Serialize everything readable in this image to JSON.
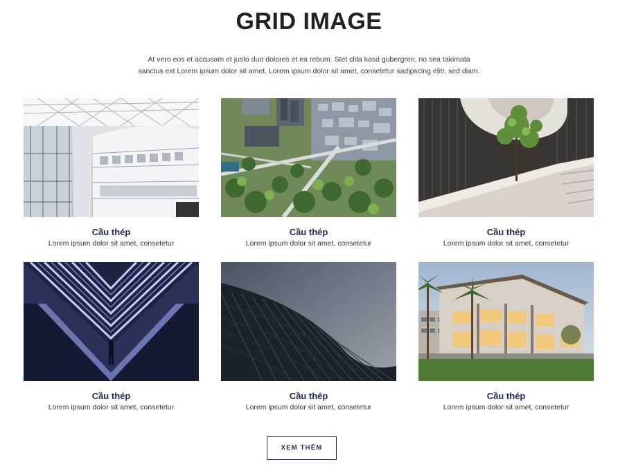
{
  "header": {
    "title": "GRID IMAGE",
    "description_line1": "At vero eos et accusam et justo duo dolores et ea rebum. Stet clita kasd gubergren, no sea takimata",
    "description_line2": "sanctus est Lorem ipsum dolor sit amet. Lorem ipsum dolor sit amet, consetetur sadipscing elitr, sed diam."
  },
  "gallery": {
    "items": [
      {
        "title": "Cầu thép",
        "description": "Lorem ipsum dolor sit amet, consetetur",
        "image": "atrium-glass-interior"
      },
      {
        "title": "Cầu thép",
        "description": "Lorem ipsum dolor sit amet, consetetur",
        "image": "aerial-city-park"
      },
      {
        "title": "Cầu thép",
        "description": "Lorem ipsum dolor sit amet, consetetur",
        "image": "spiral-staircase-tree"
      },
      {
        "title": "Cầu thép",
        "description": "Lorem ipsum dolor sit amet, consetetur",
        "image": "neon-light-corridor"
      },
      {
        "title": "Cầu thép",
        "description": "Lorem ipsum dolor sit amet, consetetur",
        "image": "curved-skyscraper-facade"
      },
      {
        "title": "Cầu thép",
        "description": "Lorem ipsum dolor sit amet, consetetur",
        "image": "modern-building-palm-trees"
      }
    ]
  },
  "footer": {
    "more_label": "XEM THÊM"
  },
  "colors": {
    "accent": "#1c2a55",
    "title": "#222222",
    "background": "#ffffff"
  }
}
